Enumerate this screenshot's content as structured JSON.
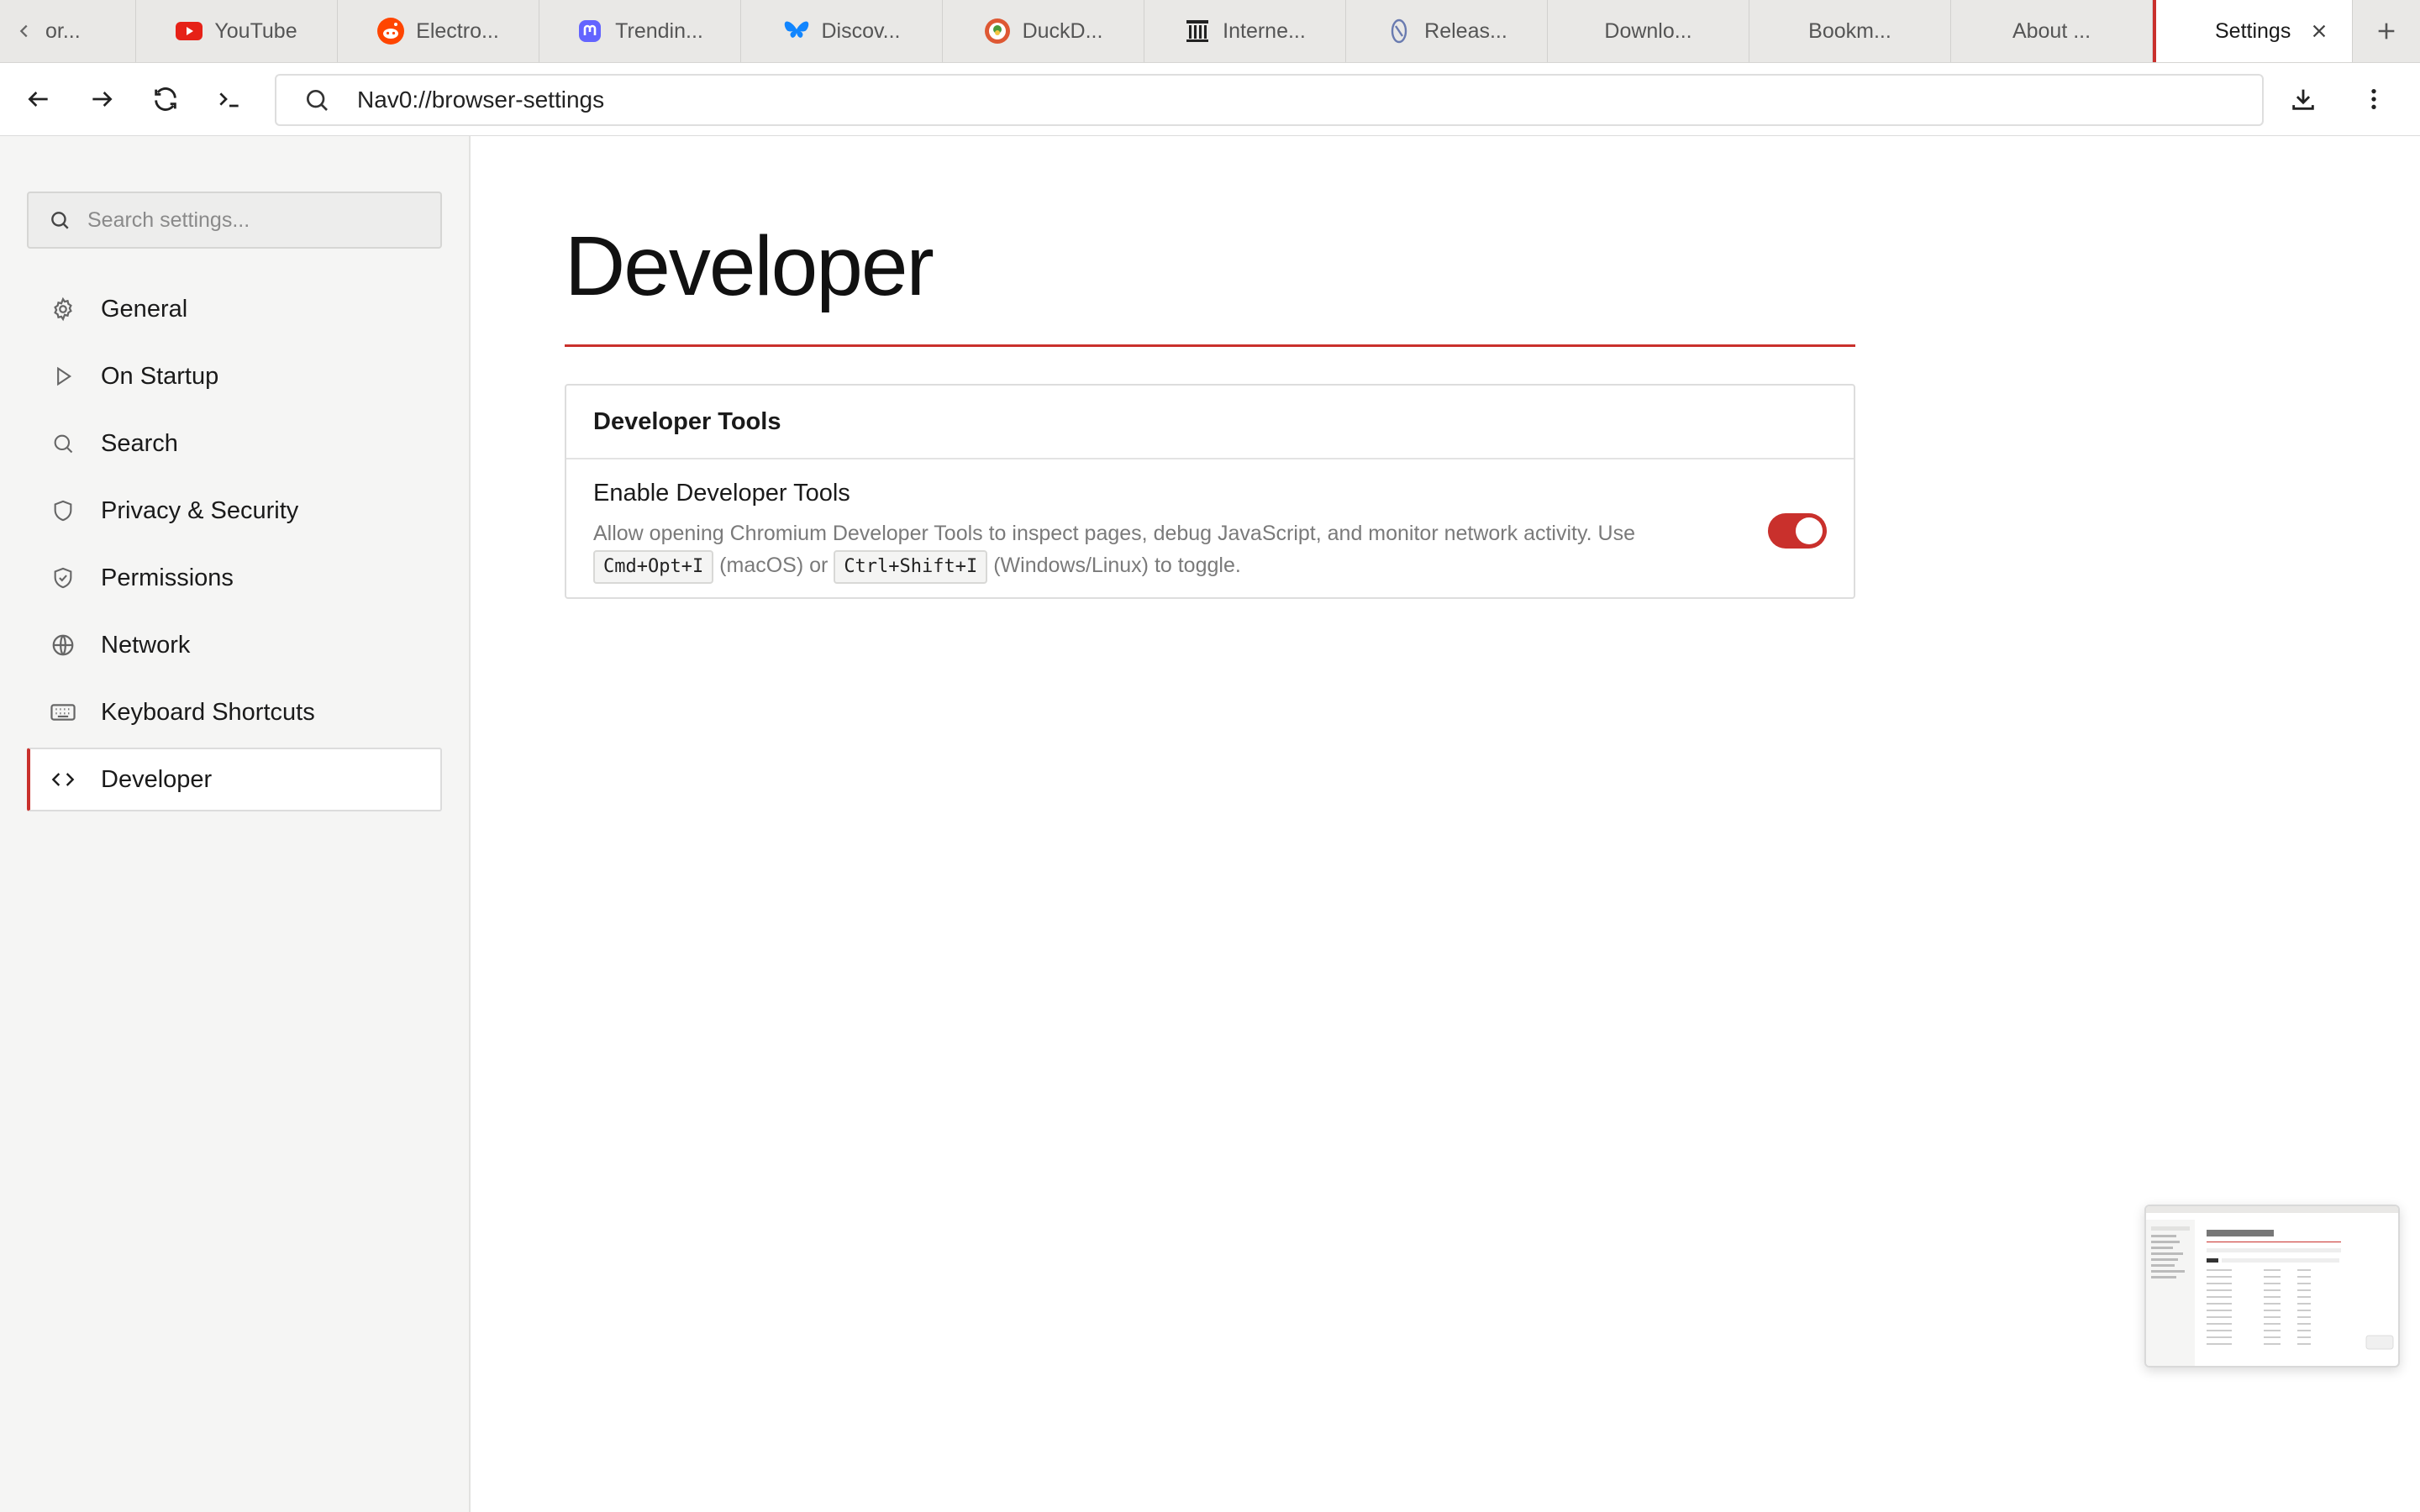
{
  "tabs": [
    {
      "label": "or...",
      "icon": "chevron-left-icon"
    },
    {
      "label": "YouTube",
      "icon": "youtube-icon",
      "color": "#e62117"
    },
    {
      "label": "Electro...",
      "icon": "reddit-icon",
      "color": "#ff4500"
    },
    {
      "label": "Trendin...",
      "icon": "mastodon-icon",
      "color": "#6364ff"
    },
    {
      "label": "Discov...",
      "icon": "bluesky-icon",
      "color": "#1185fe"
    },
    {
      "label": "DuckD...",
      "icon": "duckduckgo-icon",
      "color": "#de5833"
    },
    {
      "label": "Interne...",
      "icon": "internet-archive-icon",
      "color": "#222222"
    },
    {
      "label": "Releas...",
      "icon": "release-icon",
      "color": "#6a7bb0"
    },
    {
      "label": "Downlo...",
      "icon": ""
    },
    {
      "label": "Bookm...",
      "icon": ""
    },
    {
      "label": "About ...",
      "icon": ""
    },
    {
      "label": "Settings",
      "icon": "",
      "active": true
    }
  ],
  "toolbar": {
    "url": "Nav0://browser-settings"
  },
  "sidebar": {
    "search_placeholder": "Search settings...",
    "items": [
      {
        "label": "General",
        "icon": "gear-icon"
      },
      {
        "label": "On Startup",
        "icon": "play-icon"
      },
      {
        "label": "Search",
        "icon": "search-icon"
      },
      {
        "label": "Privacy & Security",
        "icon": "shield-icon"
      },
      {
        "label": "Permissions",
        "icon": "shield-check-icon"
      },
      {
        "label": "Network",
        "icon": "globe-icon"
      },
      {
        "label": "Keyboard Shortcuts",
        "icon": "keyboard-icon"
      },
      {
        "label": "Developer",
        "icon": "code-icon",
        "active": true
      }
    ]
  },
  "main": {
    "title": "Developer",
    "card": {
      "header": "Developer Tools",
      "setting": {
        "title": "Enable Developer Tools",
        "desc_part1": "Allow opening Chromium Developer Tools to inspect pages, debug JavaScript, and monitor network activity. Use",
        "kbd1": "Cmd+Opt+I",
        "desc_part2": "(macOS) or",
        "kbd2": "Ctrl+Shift+I",
        "desc_part3": "(Windows/Linux) to toggle.",
        "enabled": true
      }
    }
  },
  "colors": {
    "accent": "#c9302c"
  }
}
